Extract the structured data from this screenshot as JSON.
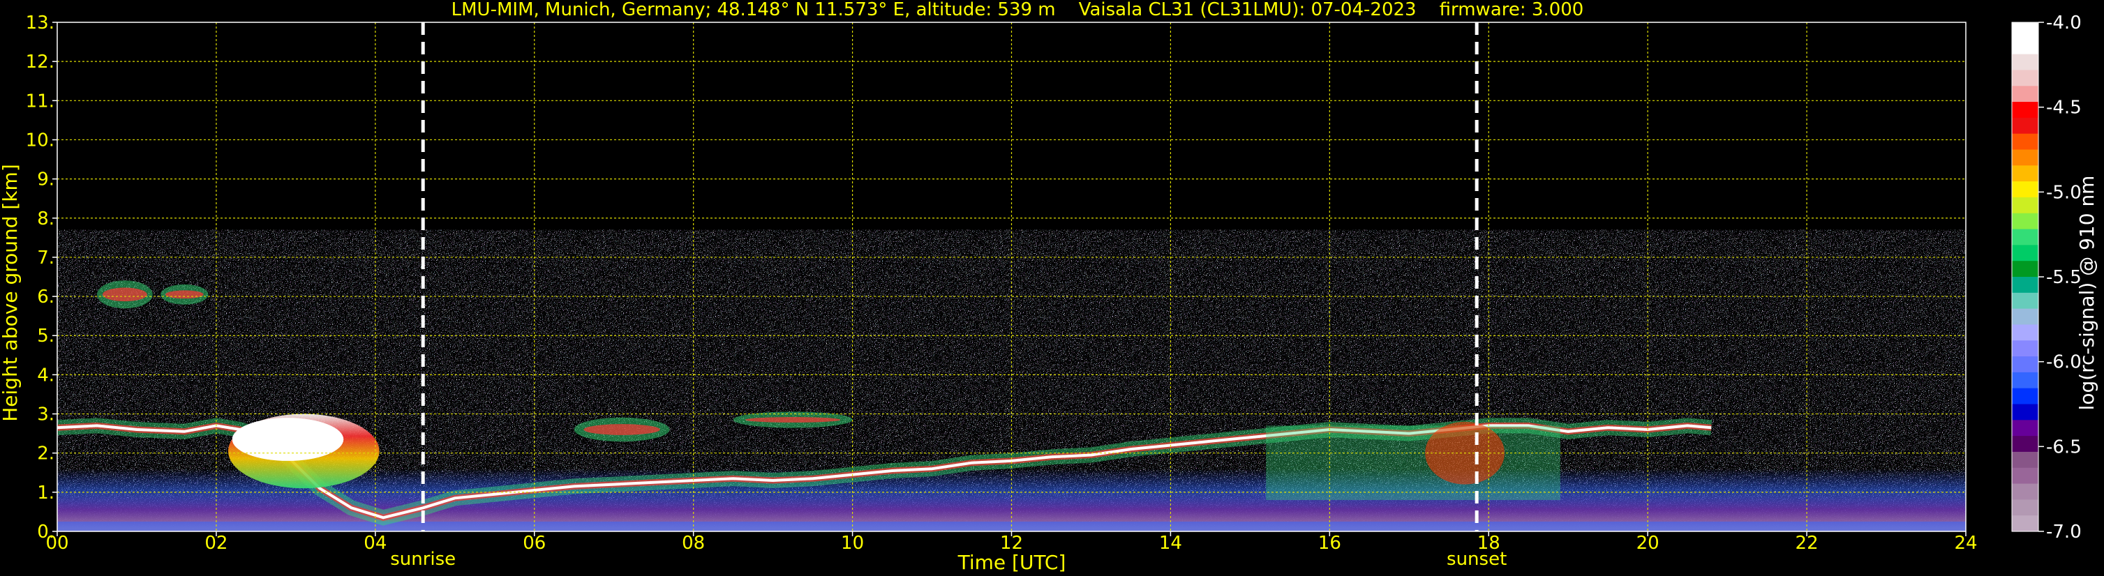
{
  "chart_data": {
    "type": "heatmap",
    "title": "LMU-MIM, Munich, Germany; 48.148° N 11.573° E, altitude: 539 m    Vaisala CL31 (CL31LMU): 07-04-2023    firmware: 3.000",
    "xlabel": "Time [UTC]",
    "ylabel": "Height above ground [km]",
    "colorbar_label": "log(rc-signal) @ 910 nm",
    "xlim": [
      0,
      24
    ],
    "ylim": [
      0,
      13
    ],
    "clim": [
      -7.0,
      -4.0
    ],
    "grid": true,
    "x_ticks": [
      "00",
      "02",
      "04",
      "06",
      "08",
      "10",
      "12",
      "14",
      "16",
      "18",
      "20",
      "22",
      "24"
    ],
    "x_tick_values": [
      0,
      2,
      4,
      6,
      8,
      10,
      12,
      14,
      16,
      18,
      20,
      22,
      24
    ],
    "y_ticks": [
      "0.",
      "1.",
      "2.",
      "3.",
      "4.",
      "5.",
      "6.",
      "7.",
      "8.",
      "9.",
      "10.",
      "11.",
      "12.",
      "13."
    ],
    "y_tick_values": [
      0,
      1,
      2,
      3,
      4,
      5,
      6,
      7,
      8,
      9,
      10,
      11,
      12,
      13
    ],
    "colorbar_ticks": [
      "-4.0",
      "-4.5",
      "-5.0",
      "-5.5",
      "-6.0",
      "-6.5",
      "-7.0"
    ],
    "colorbar_tick_values": [
      -4.0,
      -4.5,
      -5.0,
      -5.5,
      -6.0,
      -6.5,
      -7.0
    ],
    "colorbar_colors": [
      "#ffffff",
      "#ffffff",
      "#eedddd",
      "#f0c8c8",
      "#f4a0a0",
      "#ff0000",
      "#ee1111",
      "#ff5500",
      "#ff8800",
      "#ffbb00",
      "#ffee00",
      "#ccee22",
      "#88ee44",
      "#33dd77",
      "#00cc66",
      "#009922",
      "#00aa88",
      "#66ccbb",
      "#99bbdd",
      "#aaaaff",
      "#8888ff",
      "#6677ff",
      "#3366ff",
      "#0033ff",
      "#0000cc",
      "#660099",
      "#550066",
      "#885588",
      "#996699",
      "#aa88aa",
      "#b399b3",
      "#c0aac0"
    ],
    "signal_top_km": 7.7,
    "markers": [
      {
        "label": "sunrise",
        "x": 4.6
      },
      {
        "label": "sunset",
        "x": 17.85
      }
    ],
    "cloud_layer": [
      [
        0.0,
        2.65
      ],
      [
        0.5,
        2.7
      ],
      [
        1.0,
        2.6
      ],
      [
        1.6,
        2.55
      ],
      [
        2.0,
        2.7
      ],
      [
        2.3,
        2.6
      ],
      [
        2.7,
        2.3
      ],
      [
        3.0,
        1.7
      ],
      [
        3.3,
        1.1
      ],
      [
        3.7,
        0.6
      ],
      [
        4.1,
        0.35
      ],
      [
        4.6,
        0.6
      ],
      [
        5.0,
        0.85
      ],
      [
        5.5,
        0.95
      ],
      [
        6.0,
        1.05
      ],
      [
        6.5,
        1.15
      ],
      [
        7.0,
        1.2
      ],
      [
        7.5,
        1.25
      ],
      [
        8.0,
        1.3
      ],
      [
        8.5,
        1.35
      ],
      [
        9.0,
        1.3
      ],
      [
        9.5,
        1.35
      ],
      [
        10.0,
        1.45
      ],
      [
        10.5,
        1.55
      ],
      [
        11.0,
        1.6
      ],
      [
        11.5,
        1.75
      ],
      [
        12.0,
        1.8
      ],
      [
        12.5,
        1.9
      ],
      [
        13.0,
        1.95
      ],
      [
        13.5,
        2.1
      ],
      [
        14.0,
        2.2
      ],
      [
        14.5,
        2.3
      ],
      [
        15.0,
        2.4
      ],
      [
        15.5,
        2.5
      ],
      [
        16.0,
        2.6
      ],
      [
        16.5,
        2.55
      ],
      [
        17.0,
        2.5
      ],
      [
        17.5,
        2.6
      ],
      [
        18.0,
        2.7
      ],
      [
        18.5,
        2.7
      ],
      [
        19.0,
        2.55
      ],
      [
        19.5,
        2.65
      ],
      [
        20.0,
        2.6
      ],
      [
        20.5,
        2.7
      ],
      [
        20.8,
        2.65
      ]
    ],
    "upper_cloud_patches": [
      {
        "x": [
          0.5,
          1.2
        ],
        "y": [
          5.8,
          6.3
        ]
      },
      {
        "x": [
          1.3,
          1.9
        ],
        "y": [
          5.9,
          6.2
        ]
      },
      {
        "x": [
          6.5,
          7.7
        ],
        "y": [
          2.4,
          2.8
        ]
      },
      {
        "x": [
          8.5,
          10.0
        ],
        "y": [
          2.75,
          2.95
        ]
      }
    ]
  }
}
